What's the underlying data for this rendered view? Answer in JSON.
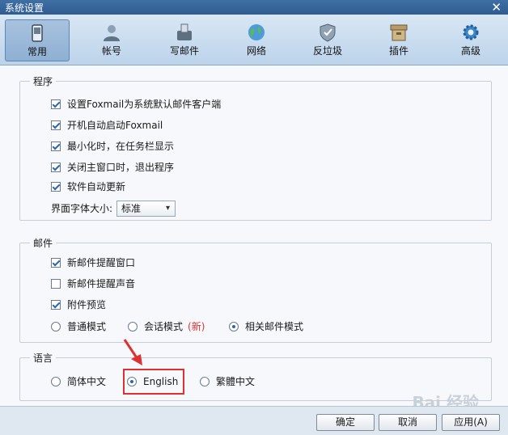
{
  "window": {
    "title": "系统设置",
    "close_glyph": "✕"
  },
  "tabs": [
    {
      "label": "常用",
      "icon": "phone-icon"
    },
    {
      "label": "帐号",
      "icon": "user-icon"
    },
    {
      "label": "写邮件",
      "icon": "compose-icon"
    },
    {
      "label": "网络",
      "icon": "globe-icon"
    },
    {
      "label": "反垃圾",
      "icon": "shield-icon"
    },
    {
      "label": "插件",
      "icon": "box-icon"
    },
    {
      "label": "高级",
      "icon": "gear-icon"
    }
  ],
  "program": {
    "legend": "程序",
    "options": [
      {
        "label": "设置Foxmail为系统默认邮件客户端",
        "checked": true
      },
      {
        "label": "开机自动启动Foxmail",
        "checked": true
      },
      {
        "label": "最小化时，在任务栏显示",
        "checked": true
      },
      {
        "label": "关闭主窗口时，退出程序",
        "checked": true
      },
      {
        "label": "软件自动更新",
        "checked": true
      }
    ],
    "font_size_label": "界面字体大小:",
    "font_size_value": "标准"
  },
  "mail": {
    "legend": "邮件",
    "options": [
      {
        "label": "新邮件提醒窗口",
        "checked": true
      },
      {
        "label": "新邮件提醒声音",
        "checked": false
      },
      {
        "label": "附件预览",
        "checked": true
      }
    ],
    "modes": [
      {
        "label": "普通模式",
        "checked": false
      },
      {
        "label": "会话模式",
        "checked": false,
        "tag": "(新)"
      },
      {
        "label": "相关邮件模式",
        "checked": true
      }
    ]
  },
  "language": {
    "legend": "语言",
    "options": [
      {
        "label": "简体中文",
        "checked": false
      },
      {
        "label": "English",
        "checked": true
      },
      {
        "label": "繁體中文",
        "checked": false
      }
    ]
  },
  "buttons": {
    "ok": "确定",
    "cancel": "取消",
    "apply": "应用(A)"
  },
  "watermark": "Bai 经验"
}
